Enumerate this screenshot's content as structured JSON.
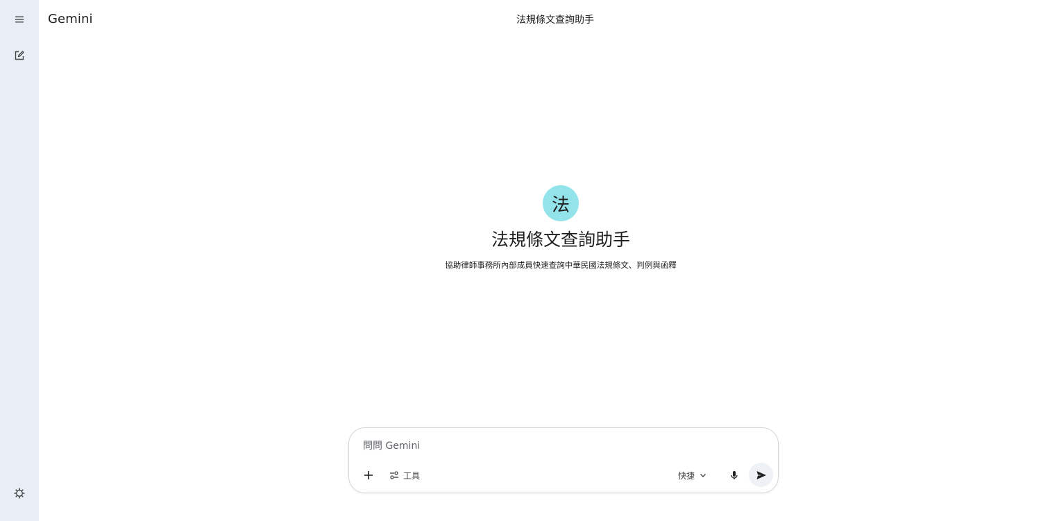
{
  "app": {
    "brand": "Gemini",
    "conversation_title": "法規條文查詢助手"
  },
  "sidebar": {
    "items": [
      {
        "icon": "menu-icon"
      },
      {
        "icon": "edit-icon"
      },
      {
        "icon": "settings-icon"
      }
    ]
  },
  "gem": {
    "avatar_letter": "法",
    "avatar_color": "#93e4ea",
    "title": "法規條文查詢助手",
    "description": "協助律師事務所內部成員快速查詢中華民國法規條文、判例與函釋"
  },
  "composer": {
    "placeholder": "問問 Gemini",
    "value": "",
    "tools_label": "工具",
    "mode_label": "快捷"
  },
  "colors": {
    "sidebar_bg": "#e9eef6",
    "accent": "#93e4ea"
  }
}
